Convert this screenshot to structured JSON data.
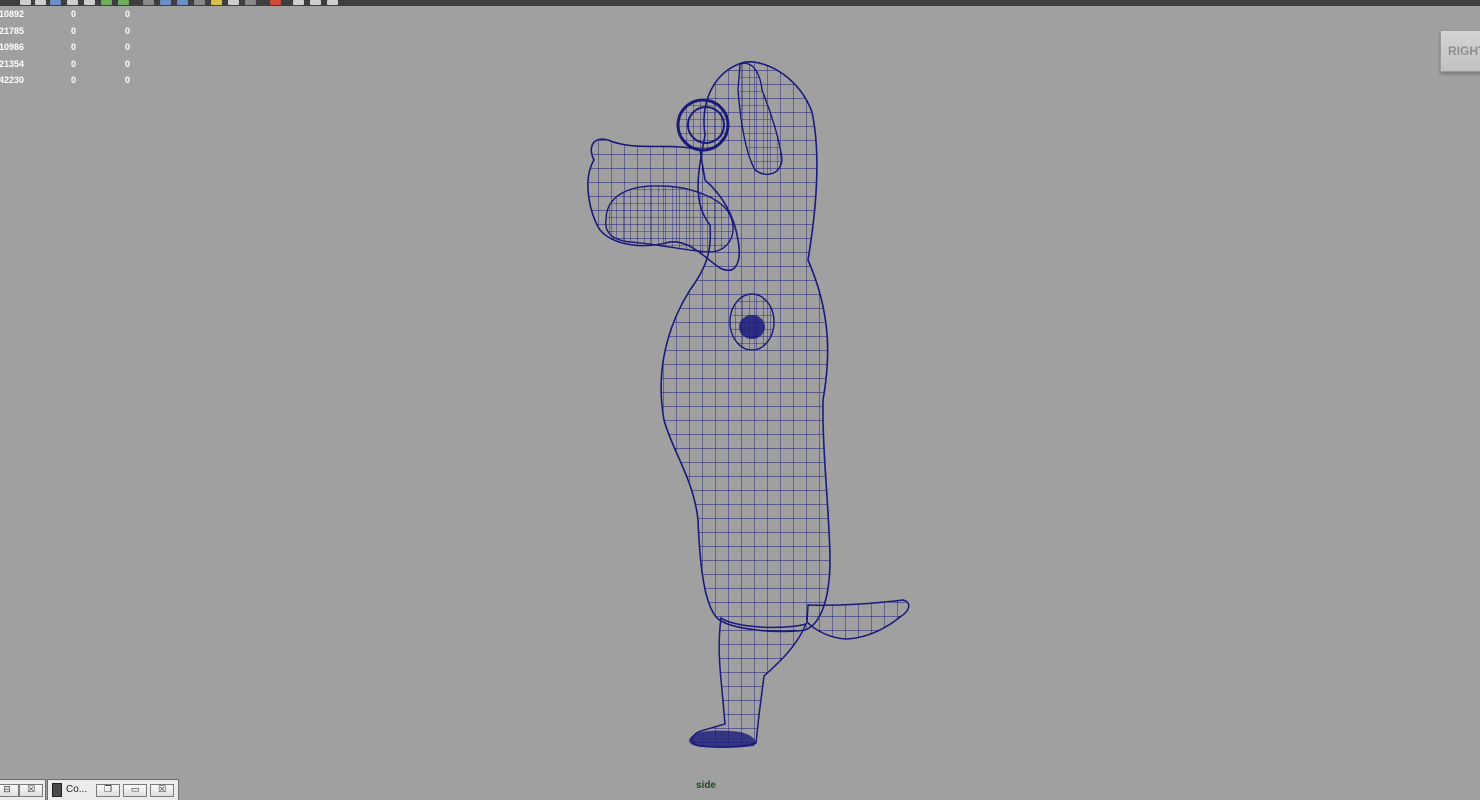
{
  "toolbar": {
    "icons": [
      "render-icon",
      "render-settings-icon",
      "hypershade-icon",
      "snapshot-icon",
      "grid-icon",
      "camera-icon",
      "light-icon",
      "shading-icon",
      "wireframe-icon",
      "smooth-shade-icon",
      "textured-icon",
      "lights-icon",
      "shadows-icon",
      "ambient-occlusion-icon",
      "motion-blur-icon",
      "anti-alias-icon",
      "isolate-icon",
      "xray-icon",
      "joint-xray-icon",
      "resolution-gate-icon"
    ]
  },
  "hud": {
    "rows": [
      {
        "c0": "10892",
        "c1": "0",
        "c2": "0"
      },
      {
        "c0": "21785",
        "c1": "0",
        "c2": "0"
      },
      {
        "c0": "10986",
        "c1": "0",
        "c2": "0"
      },
      {
        "c0": "21354",
        "c1": "0",
        "c2": "0"
      },
      {
        "c0": "42230",
        "c1": "0",
        "c2": "0"
      }
    ]
  },
  "viewcube": {
    "label": "RIGHT"
  },
  "viewport": {
    "camera": "side",
    "background": "#a0a0a0",
    "wire_color": "#1a1a7a"
  },
  "taskbar": {
    "window1": {
      "restore": "⊟",
      "close": "☒"
    },
    "window2": {
      "title": "Co...",
      "restore": "❐",
      "maximize": "▭",
      "close": "☒"
    }
  }
}
